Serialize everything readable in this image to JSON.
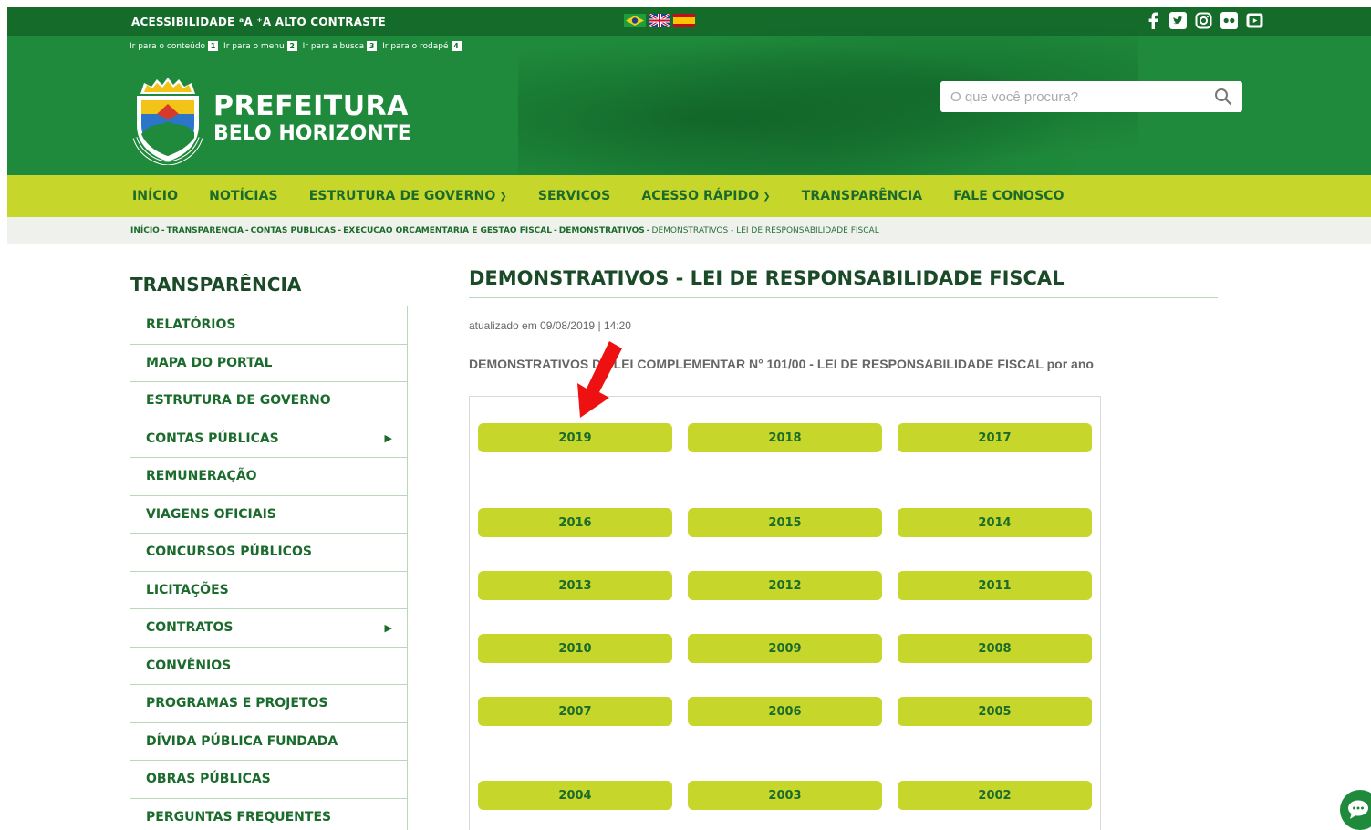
{
  "header": {
    "accessibility_label": "ACESSIBILIDADE  ᵃA ⁺A  ALTO CONTRASTE",
    "shortcuts": [
      {
        "label": "Ir para o conteúdo",
        "key": "1"
      },
      {
        "label": "Ir para o menu",
        "key": "2"
      },
      {
        "label": "Ir para a busca",
        "key": "3"
      },
      {
        "label": "Ir para o rodapé",
        "key": "4"
      }
    ],
    "brand_line1": "PREFEITURA",
    "brand_line2": "BELO HORIZONTE",
    "search_placeholder": "O que você procura?",
    "flags": [
      "brazil-flag-icon",
      "uk-flag-icon",
      "spain-flag-icon"
    ],
    "social_icons": [
      "facebook-icon",
      "twitter-icon",
      "instagram-icon",
      "flickr-icon",
      "youtube-icon"
    ]
  },
  "nav": {
    "items": [
      {
        "label": "INÍCIO",
        "dropdown": false
      },
      {
        "label": "NOTÍCIAS",
        "dropdown": false
      },
      {
        "label": "ESTRUTURA DE GOVERNO",
        "dropdown": true
      },
      {
        "label": "SERVIÇOS",
        "dropdown": false
      },
      {
        "label": "ACESSO RÁPIDO",
        "dropdown": true
      },
      {
        "label": "TRANSPARÊNCIA",
        "dropdown": false
      },
      {
        "label": "FALE CONOSCO",
        "dropdown": false
      }
    ]
  },
  "breadcrumb": {
    "items": [
      "INÍCIO",
      "TRANSPARENCIA",
      "CONTAS PUBLICAS",
      "EXECUCAO ORCAMENTARIA E GESTAO FISCAL",
      "DEMONSTRATIVOS"
    ],
    "current": "DEMONSTRATIVOS - LEI DE RESPONSABILIDADE FISCAL",
    "separator": " - "
  },
  "sidebar": {
    "title": "TRANSPARÊNCIA",
    "items": [
      {
        "label": "RELATÓRIOS",
        "submenu": false
      },
      {
        "label": "MAPA DO PORTAL",
        "submenu": false
      },
      {
        "label": "ESTRUTURA DE GOVERNO",
        "submenu": false
      },
      {
        "label": "CONTAS PÚBLICAS",
        "submenu": true
      },
      {
        "label": "REMUNERAÇÃO",
        "submenu": false
      },
      {
        "label": "VIAGENS OFICIAIS",
        "submenu": false
      },
      {
        "label": "CONCURSOS PÚBLICOS",
        "submenu": false
      },
      {
        "label": "LICITAÇÕES",
        "submenu": false
      },
      {
        "label": "CONTRATOS",
        "submenu": true
      },
      {
        "label": "CONVÊNIOS",
        "submenu": false
      },
      {
        "label": "PROGRAMAS E PROJETOS",
        "submenu": false
      },
      {
        "label": "DÍVIDA PÚBLICA FUNDADA",
        "submenu": false
      },
      {
        "label": "OBRAS PÚBLICAS",
        "submenu": false
      },
      {
        "label": "PERGUNTAS FREQUENTES",
        "submenu": false
      }
    ]
  },
  "main": {
    "title": "DEMONSTRATIVOS - LEI DE RESPONSABILIDADE FISCAL",
    "updated": "atualizado em 09/08/2019 | 14:20",
    "lead": "DEMONSTRATIVOS DA LEI COMPLEMENTAR N° 101/00 - LEI DE RESPONSABILIDADE FISCAL por ano",
    "year_rows": [
      [
        "2019",
        "2018",
        "2017"
      ],
      [
        "2016",
        "2015",
        "2014"
      ],
      [
        "2013",
        "2012",
        "2011"
      ],
      [
        "2010",
        "2009",
        "2008"
      ],
      [
        "2007",
        "2006",
        "2005"
      ],
      [
        "2004",
        "2003",
        "2002"
      ]
    ]
  },
  "colors": {
    "header_green": "#1f8a3b",
    "topstrip_green": "#146b2a",
    "accent_lime": "#c7d62b",
    "text_green": "#1b6b2c",
    "annotation_red": "#ee1111"
  }
}
